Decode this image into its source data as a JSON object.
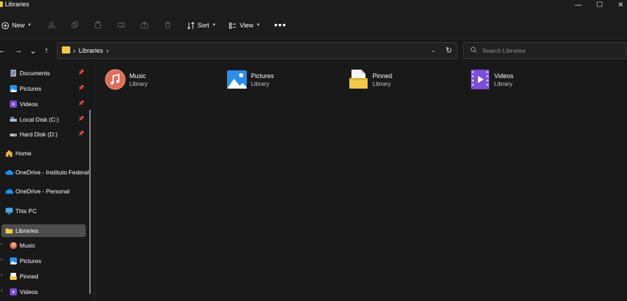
{
  "window": {
    "title": "Libraries",
    "controls": {
      "minimize": "—",
      "maximize": "☐",
      "close": "✕"
    }
  },
  "toolbar": {
    "new_label": "New",
    "sort_label": "Sort",
    "view_label": "View",
    "more_label": "•••",
    "icons": [
      "cut-icon",
      "copy-icon",
      "paste-icon",
      "rename-icon",
      "share-icon",
      "delete-icon"
    ]
  },
  "navigation": {
    "back": "←",
    "forward": "→",
    "recent": "⌄",
    "up": "↑",
    "breadcrumb_sep": "›",
    "breadcrumb_item": "Libraries",
    "breadcrumb_trail": "›",
    "dropdown": "⌄",
    "refresh": "↻"
  },
  "search": {
    "placeholder": "Search Libraries",
    "value": ""
  },
  "sidebar": {
    "quick_access": [
      {
        "label": "Documents",
        "icon": "documents-icon",
        "pinned": true
      },
      {
        "label": "Pictures",
        "icon": "pictures-icon",
        "pinned": true
      },
      {
        "label": "Videos",
        "icon": "videos-icon",
        "pinned": true
      },
      {
        "label": "Local Disk (C:)",
        "icon": "drive-icon",
        "pinned": true
      },
      {
        "label": "Hard Disk (D:)",
        "icon": "drive-icon",
        "pinned": true
      }
    ],
    "locations": [
      {
        "label": "Home",
        "icon": "home-icon"
      },
      {
        "label": "OneDrive - Instituto Federal",
        "icon": "onedrive-icon"
      },
      {
        "label": "OneDrive - Personal",
        "icon": "onedrive-icon"
      },
      {
        "label": "This PC",
        "icon": "pc-icon"
      },
      {
        "label": "Libraries",
        "icon": "libraries-icon",
        "selected": true
      }
    ],
    "library_children": [
      {
        "label": "Music",
        "icon": "music-icon"
      },
      {
        "label": "Pictures",
        "icon": "pictures-icon"
      },
      {
        "label": "Pinned",
        "icon": "pinned-icon"
      },
      {
        "label": "Videos",
        "icon": "videos-icon"
      }
    ],
    "pin_glyph": "📌",
    "expander_glyph": "›"
  },
  "libraries": [
    {
      "name": "Music",
      "type": "Library",
      "icon": "music-library-icon"
    },
    {
      "name": "Pictures",
      "type": "Library",
      "icon": "pictures-library-icon"
    },
    {
      "name": "Pinned",
      "type": "Library",
      "icon": "pinned-library-icon"
    },
    {
      "name": "Videos",
      "type": "Library",
      "icon": "videos-library-icon"
    }
  ],
  "colors": {
    "background": "#191919",
    "folder": "#f2c94c",
    "selected": "#4d4d4d",
    "accent_blue": "#1e90ff",
    "music": "#e06c5a",
    "video": "#7b4fd6"
  }
}
